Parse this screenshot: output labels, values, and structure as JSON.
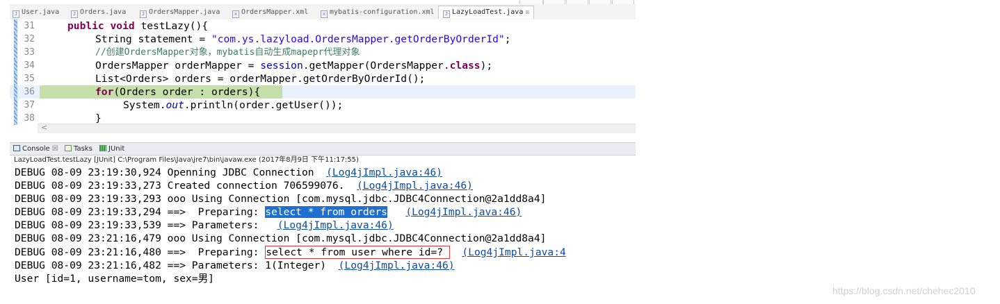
{
  "tabs": [
    {
      "label": "User.java",
      "icon": "java-file-icon"
    },
    {
      "label": "Orders.java",
      "icon": "java-file-icon"
    },
    {
      "label": "OrdersMapper.java",
      "icon": "java-file-icon"
    },
    {
      "label": "OrdersMapper.xml",
      "icon": "xml-file-icon"
    },
    {
      "label": "mybatis-configuration.xml",
      "icon": "xml-file-icon"
    },
    {
      "label": "LazyLoadTest.java",
      "icon": "java-file-icon",
      "active": true,
      "close": "☒"
    }
  ],
  "editor": {
    "line_numbers": [
      "31",
      "32",
      "33",
      "34",
      "35",
      "36",
      "37",
      "38"
    ],
    "lines": [
      {
        "parts": [
          "",
          "public",
          " ",
          "void",
          " testLazy(){"
        ]
      },
      {
        "parts": [
          "String statement = ",
          "\"com.ys.lazyload.OrdersMapper.getOrderByOrderId\"",
          ";"
        ]
      },
      {
        "parts": [
          "//创建OrdersMapper对象，mybatis自动生成mapepr代理对象"
        ]
      },
      {
        "parts": [
          "OrdersMapper orderMapper = ",
          "session",
          ".getMapper(OrdersMapper.",
          "class",
          ");"
        ]
      },
      {
        "parts": [
          "List<Orders> orders = orderMapper.getOrderByOrderId();"
        ]
      },
      {
        "parts": [
          "for",
          "(Orders order : orders){"
        ]
      },
      {
        "parts": [
          "System.",
          "out",
          ".println(order.getUser());"
        ]
      },
      {
        "parts": [
          "}"
        ]
      }
    ]
  },
  "scroll_arrow": "<",
  "console_tabs": [
    {
      "label": "Console",
      "close": "☒"
    },
    {
      "label": "Tasks"
    },
    {
      "label": "JUnit"
    }
  ],
  "console": {
    "status": "LazyLoadTest.testLazy [JUnit] C:\\Program Files\\Java\\jre7\\bin\\javaw.exe (2017年8月9日 下午11:17:55)",
    "lines": [
      {
        "text": "DEBUG 08-09 23:19:30,924 Openning JDBC Connection  ",
        "link": "(Log4jImpl.java:46)",
        "tail": ""
      },
      {
        "text": "DEBUG 08-09 23:19:33,273 Created connection 706599076.  ",
        "link": "(Log4jImpl.java:46)",
        "tail": ""
      },
      {
        "text": "DEBUG 08-09 23:19:33,293 ooo Using Connection [com.mysql.jdbc.JDBC4Connection@2a1dd8a4]",
        "link": "",
        "tail": ""
      },
      {
        "text": "DEBUG 08-09 23:19:33,294 ==>  Preparing: ",
        "highlight": "select * from orders",
        "mid": "   ",
        "link": "(Log4jImpl.java:46)"
      },
      {
        "text": "DEBUG 08-09 23:19:33,539 ==> Parameters:   ",
        "link": "(Log4jImpl.java:46)",
        "tail": ""
      },
      {
        "text": "DEBUG 08-09 23:21:16,479 ooo Using Connection [com.mysql.jdbc.JDBC4Connection@2a1dd8a4]",
        "link": "",
        "tail": ""
      },
      {
        "text": "DEBUG 08-09 23:21:16,480 ==>  Preparing: ",
        "boxed": "select * from user where id=? ",
        "mid": "  ",
        "link": "(Log4jImpl.java:4"
      },
      {
        "text": "DEBUG 08-09 23:21:16,482 ==> Parameters: 1(Integer)  ",
        "link": "(Log4jImpl.java:46)",
        "tail": ""
      },
      {
        "text": "User [id=1, username=tom, sex=男]",
        "link": "",
        "tail": ""
      }
    ]
  },
  "watermark": "https://blog.csdn.net/chehec2010"
}
